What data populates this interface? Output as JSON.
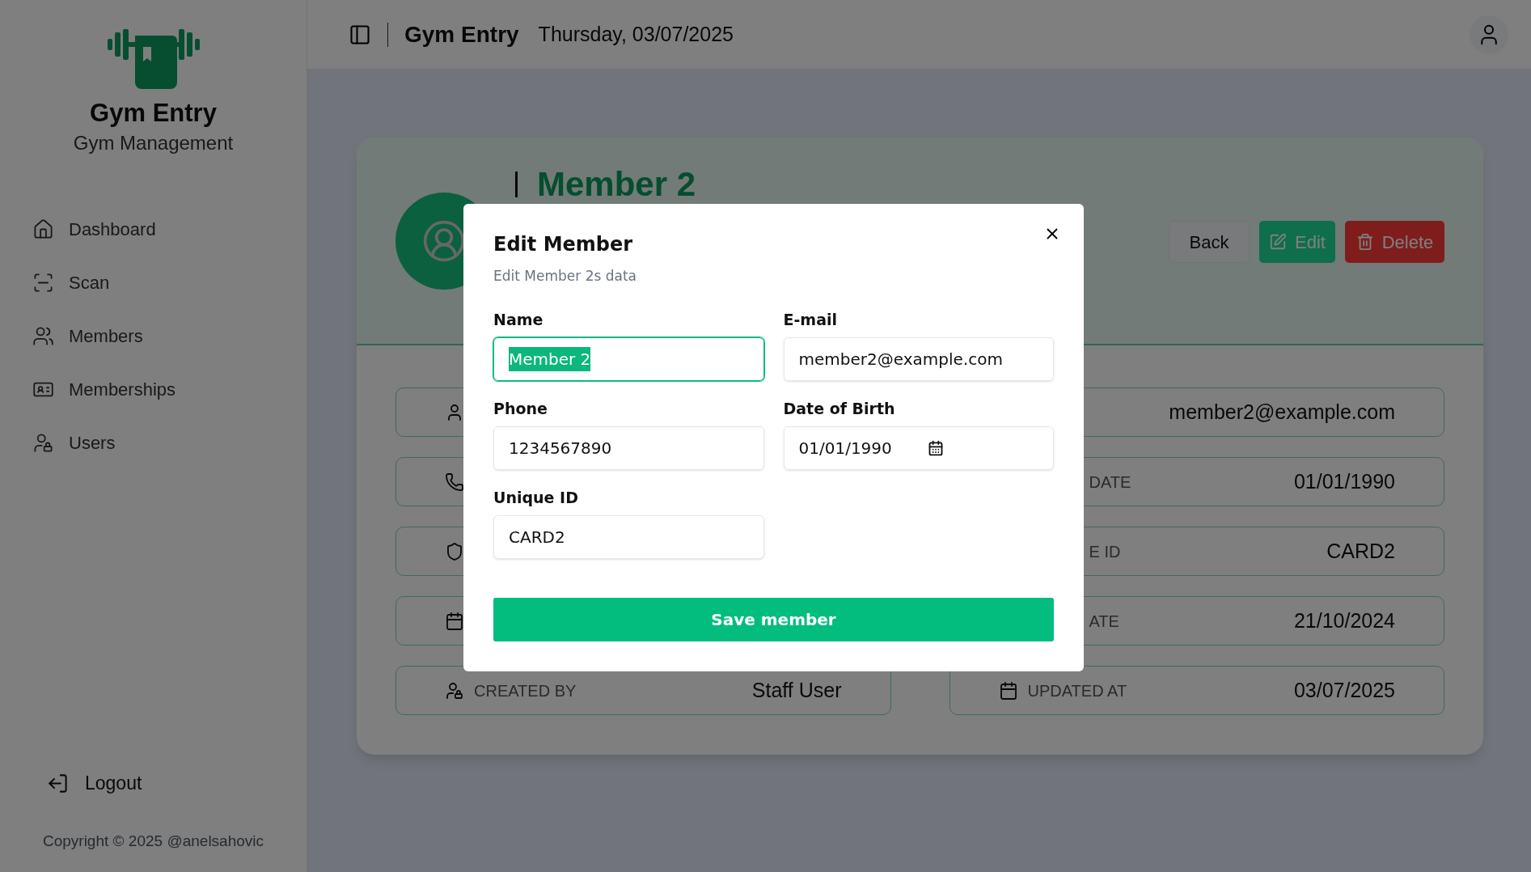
{
  "sidebar": {
    "app_name": "Gym Entry",
    "subtitle": "Gym Management",
    "nav": [
      {
        "label": "Dashboard",
        "kind": "home"
      },
      {
        "label": "Scan",
        "kind": "scan"
      },
      {
        "label": "Members",
        "kind": "users"
      },
      {
        "label": "Memberships",
        "kind": "card"
      },
      {
        "label": "Users",
        "kind": "userlock"
      }
    ],
    "logout": "Logout",
    "copyright": "Copyright © 2025 @anelsahovic"
  },
  "header": {
    "title": "Gym Entry",
    "date": "Thursday, 03/07/2025"
  },
  "member": {
    "name": "Member 2",
    "actions": [
      {
        "label": "Back",
        "kind": "back"
      },
      {
        "label": "Edit",
        "kind": "edit"
      },
      {
        "label": "Delete",
        "kind": "delete"
      }
    ],
    "details": [
      {
        "kind": "user"
      },
      {
        "kind": "hidden",
        "value": "member2@example.com"
      },
      {
        "kind": "phone"
      },
      {
        "kind": "hidden",
        "label": "DATE",
        "value": "01/01/1990"
      },
      {
        "kind": "shield"
      },
      {
        "kind": "hidden",
        "label": "E ID",
        "value": "CARD2"
      },
      {
        "kind": "calendar"
      },
      {
        "kind": "hidden",
        "label": "ATE",
        "value": "21/10/2024"
      },
      {
        "kind": "userlock",
        "label": "CREATED BY",
        "value": "Staff User"
      },
      {
        "kind": "calendar",
        "label": "UPDATED AT",
        "value": "03/07/2025"
      }
    ]
  },
  "dialog": {
    "title": "Edit Member",
    "description": "Edit Member 2s data",
    "fields": [
      {
        "label": "Name",
        "value": "Member 2",
        "kind": "text",
        "focused": true
      },
      {
        "label": "E-mail",
        "value": "member2@example.com",
        "kind": "text",
        "focused": false
      },
      {
        "label": "Phone",
        "value": "1234567890",
        "kind": "text",
        "focused": false
      },
      {
        "label": "Date of Birth",
        "value": "01/01/1990",
        "kind": "date",
        "focused": false
      },
      {
        "label": "Unique ID",
        "value": "CARD2",
        "kind": "text",
        "focused": false
      }
    ],
    "submit": "Save member"
  }
}
